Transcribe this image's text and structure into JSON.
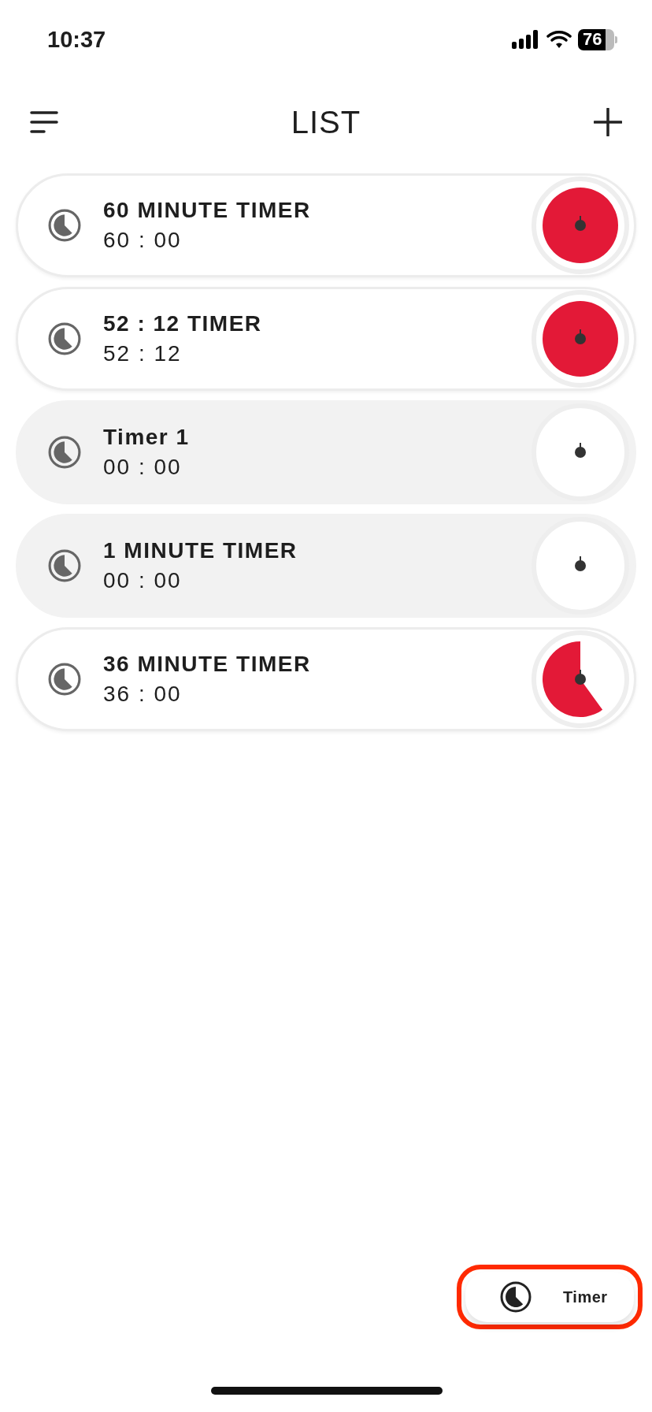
{
  "status_bar": {
    "time": "10:37",
    "battery": "76"
  },
  "header": {
    "title": "LIST"
  },
  "timers": [
    {
      "name": "60 MINUTE TIMER",
      "time": "60 : 00",
      "active": true
    },
    {
      "name": "52 : 12 TIMER",
      "time": "52 : 12",
      "active": true
    },
    {
      "name": "Timer 1",
      "time": "00 : 00",
      "active": false
    },
    {
      "name": "1 MINUTE TIMER",
      "time": "00 : 00",
      "active": false
    },
    {
      "name": "36 MINUTE TIMER",
      "time": "36 : 00",
      "active": true
    }
  ],
  "timer_button": {
    "label": "Timer",
    "highlighted": true
  }
}
